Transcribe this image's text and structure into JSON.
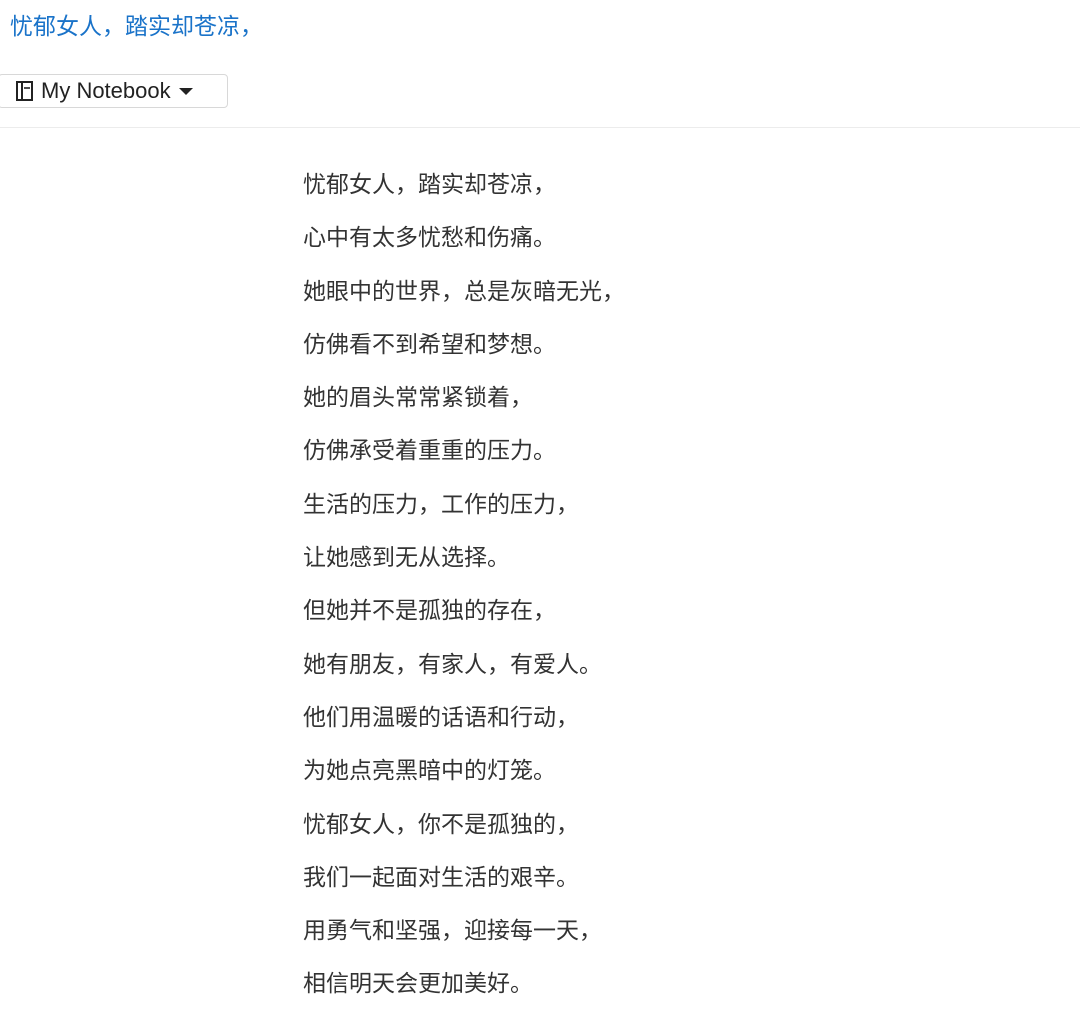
{
  "header": {
    "title": "忧郁女人，踏实却苍凉，"
  },
  "toolbar": {
    "notebook_icon": "notebook-icon",
    "notebook_label": "My Notebook",
    "dropdown_icon": "chevron-down-icon"
  },
  "colors": {
    "link_blue": "#1a73c9",
    "body_text": "#333333"
  },
  "content": {
    "lines": [
      "忧郁女人，踏实却苍凉，",
      "心中有太多忧愁和伤痛。",
      "她眼中的世界，总是灰暗无光，",
      "仿佛看不到希望和梦想。",
      "她的眉头常常紧锁着，",
      "仿佛承受着重重的压力。",
      "生活的压力，工作的压力，",
      "让她感到无从选择。",
      "但她并不是孤独的存在，",
      "她有朋友，有家人，有爱人。",
      "他们用温暖的话语和行动，",
      "为她点亮黑暗中的灯笼。",
      "忧郁女人，你不是孤独的，",
      "我们一起面对生活的艰辛。",
      "用勇气和坚强，迎接每一天，",
      "相信明天会更加美好。"
    ]
  }
}
